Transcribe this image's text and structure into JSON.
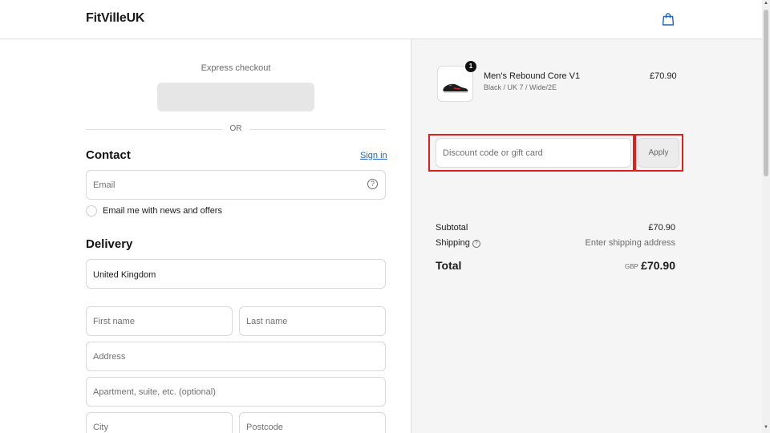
{
  "header": {
    "logo": "FitVilleUK",
    "cart_icon": "shopping-bag-icon"
  },
  "express": {
    "label": "Express checkout",
    "or_text": "OR"
  },
  "contact": {
    "title": "Contact",
    "sign_in": "Sign in",
    "email_placeholder": "Email",
    "newsletter_label": "Email me with news and offers"
  },
  "delivery": {
    "title": "Delivery",
    "country_value": "United Kingdom",
    "first_name_placeholder": "First name",
    "last_name_placeholder": "Last name",
    "address_placeholder": "Address",
    "apartment_placeholder": "Apartment, suite, etc. (optional)",
    "city_placeholder": "City",
    "postcode_placeholder": "Postcode"
  },
  "order": {
    "product": {
      "name": "Men's Rebound Core V1",
      "variant": "Black / UK 7 / Wide/2E",
      "price": "£70.90",
      "quantity": "1"
    },
    "discount_placeholder": "Discount code or gift card",
    "apply_label": "Apply",
    "subtotal_label": "Subtotal",
    "subtotal_value": "£70.90",
    "shipping_label": "Shipping",
    "shipping_value": "Enter shipping address",
    "total_label": "Total",
    "currency": "GBP",
    "total_value": "£70.90"
  },
  "colors": {
    "accent_link": "#1769c4",
    "highlight": "#e0201d"
  }
}
